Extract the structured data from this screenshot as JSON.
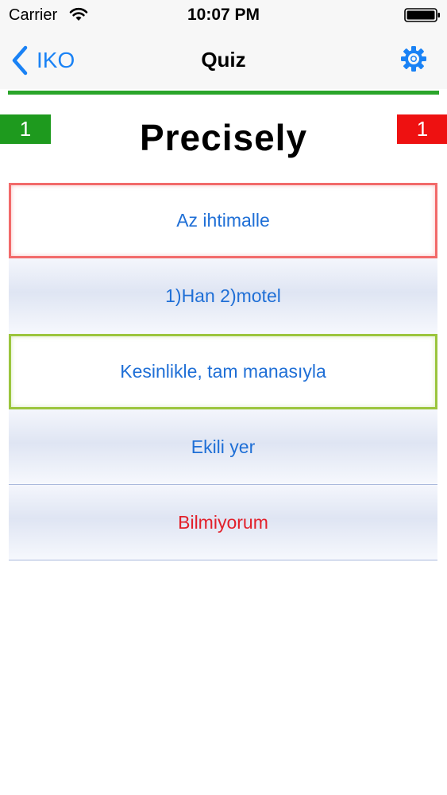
{
  "status_bar": {
    "carrier": "Carrier",
    "time": "10:07 PM"
  },
  "nav": {
    "back_label": "IKO",
    "title": "Quiz"
  },
  "scores": {
    "correct": "1",
    "wrong": "1"
  },
  "quiz": {
    "word": "Precisely",
    "answers": [
      {
        "label": "Az ihtimalle",
        "state": "wrong"
      },
      {
        "label": "1)Han 2)motel",
        "state": "normal"
      },
      {
        "label": "Kesinlikle, tam manasıyla",
        "state": "correct"
      },
      {
        "label": "Ekili yer",
        "state": "normal"
      },
      {
        "label": "Bilmiyorum",
        "state": "dont-know"
      }
    ]
  },
  "colors": {
    "accent": "#1a82f5",
    "progress": "#2aa52a",
    "correct_badge": "#1e9a1e",
    "wrong_badge": "#ee1111",
    "wrong_border": "#f26a6a",
    "correct_border": "#9bc53d",
    "dont_know_text": "#e2202a"
  },
  "icons": {
    "wifi": "wifi-icon",
    "battery": "battery-icon",
    "back": "chevron-left-icon",
    "settings": "gear-icon"
  }
}
